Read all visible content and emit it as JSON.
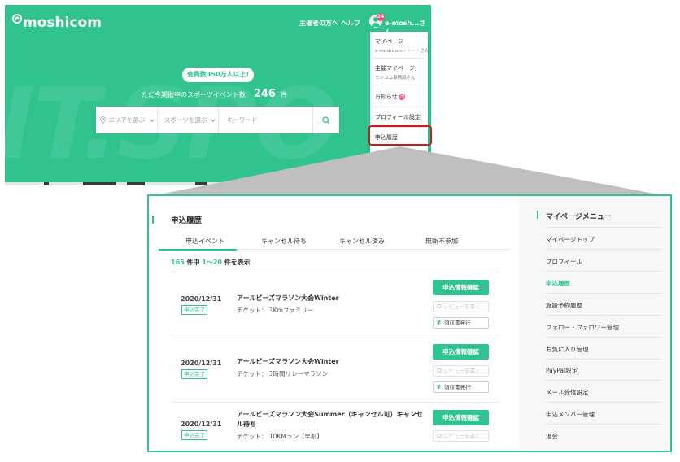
{
  "site": {
    "logo": "moshicom",
    "logo_mark": "e",
    "bg_word": "IT.SPO",
    "nav": {
      "organizer_link": "主催者の方へ",
      "help_link": "ヘルプ"
    },
    "user": {
      "notification_count": "24",
      "name": "e-mosh...さん"
    },
    "hero": {
      "members_pill": "会員数350万人以上!",
      "events_prefix": "ただ今開催中のスポーツイベント数",
      "events_count": "246",
      "events_unit": "件"
    },
    "search": {
      "area_placeholder": "エリアを選ぶ",
      "sport_placeholder": "スポーツを選ぶ",
      "keyword_placeholder": "キーワード"
    },
    "dropdown": {
      "mypage": {
        "label": "マイページ",
        "sub": "e-moshicom・・・・さん"
      },
      "organizer_mypage": {
        "label": "主催マイページ",
        "sub": "モシコム事務局さん"
      },
      "notifications": {
        "label": "お知らせ",
        "badge": "30"
      },
      "profile_settings": "プロフィール設定",
      "application_history": "申込履歴"
    }
  },
  "panel": {
    "title": "申込履歴",
    "tabs": [
      "申込イベント",
      "キャンセル待ち",
      "キャンセル済み",
      "無断不参加"
    ],
    "count": {
      "total": "165",
      "mid": "件中",
      "range": "1〜20",
      "suffix": "件を表示"
    },
    "buttons": {
      "confirm": "申込情報確認",
      "review": "レビューを書く",
      "receipt": "領収書発行",
      "yen": "¥"
    },
    "rows": [
      {
        "date": "2020/12/31",
        "status": "申込完了",
        "title": "アールビーズマラソン大会Winter",
        "ticket": "チケット： 3Kmファミリー"
      },
      {
        "date": "2020/12/31",
        "status": "申込完了",
        "title": "アールビーズマラソン大会Winter",
        "ticket": "チケット： 3時間リレーマラソン"
      },
      {
        "date": "2020/12/31",
        "status": "申込完了",
        "title_line1": "アールビーズマラソン大会Summer（キャンセル可）キャンセ",
        "title_line2": "ル待ち",
        "ticket": "チケット： 10KMラン【早割】"
      }
    ]
  },
  "sidebar": {
    "title": "マイページメニュー",
    "items": [
      {
        "label": "マイページトップ",
        "active": false
      },
      {
        "label": "プロフィール",
        "active": false
      },
      {
        "label": "申込履歴",
        "active": true
      },
      {
        "label": "施設予約履歴",
        "active": false
      },
      {
        "label": "フォロー・フォロワー管理",
        "active": false
      },
      {
        "label": "お気に入り管理",
        "active": false
      },
      {
        "label": "PayPal設定",
        "active": false
      },
      {
        "label": "メール受信設定",
        "active": false
      },
      {
        "label": "申込メンバー管理",
        "active": false
      },
      {
        "label": "退会",
        "active": false
      }
    ]
  },
  "colors": {
    "brand_green": "#30c38e",
    "highlight_red": "#cc1b16",
    "badge_pink": "#f04b7a"
  }
}
